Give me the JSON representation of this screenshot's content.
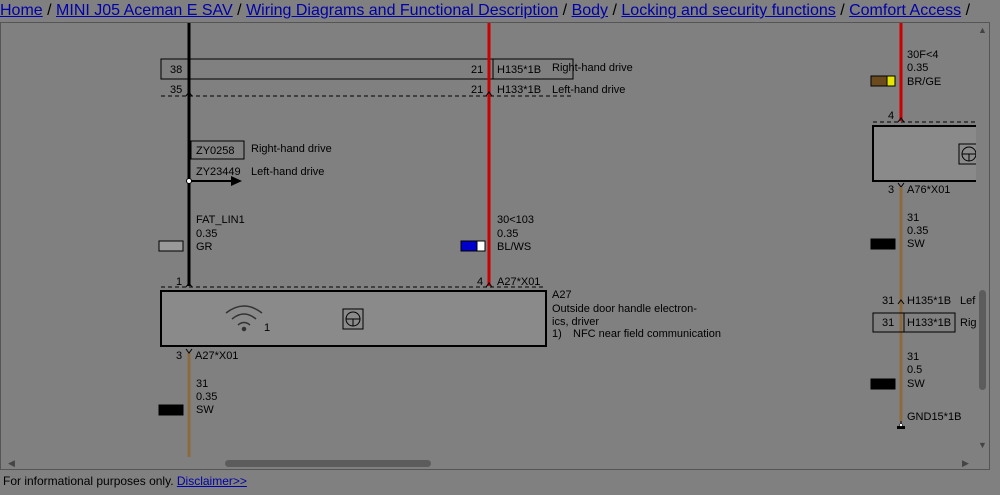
{
  "breadcrumb": {
    "items": [
      "Home",
      "MINI J05 Aceman E SAV",
      "Wiring Diagrams and Functional Description",
      "Body",
      "Locking and security functions",
      "Comfort Access"
    ],
    "separator": "/"
  },
  "diagram": {
    "pin38": "38",
    "pin21a": "21",
    "conn_h135_top": "H135*1B",
    "rhd_top": "Right-hand drive",
    "pin35": "35",
    "pin21b": "21",
    "conn_h133_top": "H133*1B",
    "lhd_top": "Left-hand drive",
    "zy0258": "ZY0258",
    "zy0258_label": "Right-hand drive",
    "zy23449": "ZY23449",
    "zy23449_label": "Left-hand drive",
    "wire_left_name": "FAT_LIN1",
    "wire_left_size": "0.35",
    "wire_left_color": "GR",
    "wire_mid_name": "30<103",
    "wire_mid_size": "0.35",
    "wire_mid_color": "BL/WS",
    "pin1": "1",
    "pin4": "4",
    "conn_a27x01_top": "A27*X01",
    "a27_id": "A27",
    "a27_desc1": "Outside door handle electron-",
    "a27_desc2": "ics, driver",
    "a27_note_num": "1)",
    "a27_note": "NFC near field communication",
    "a27_icon_num": "1",
    "pin3": "3",
    "conn_a27x01_bot": "A27*X01",
    "wire_bot_name": "31",
    "wire_bot_size": "0.35",
    "wire_bot_color": "SW",
    "right_wire1_name": "30F<4",
    "right_wire1_size": "0.35",
    "right_wire1_color": "BR/GE",
    "right_pin4": "4",
    "right_pin3": "3",
    "right_conn_a76": "A76*X01",
    "right_wire2_name": "31",
    "right_wire2_size": "0.35",
    "right_wire2_color": "SW",
    "right_pin31a": "31",
    "right_conn_h135": "H135*1B",
    "right_lef": "Lef",
    "right_pin31b": "31",
    "right_conn_h133": "H133*1B",
    "right_rig": "Rig",
    "right_wire3_name": "31",
    "right_wire3_size": "0.5",
    "right_wire3_color": "SW",
    "right_gnd": "GND15*1B"
  },
  "footer": {
    "text": "For informational purposes only.",
    "link": "Disclaimer>>"
  },
  "colors": {
    "background": "#808080",
    "red_wire": "#cc0000",
    "brown_wire": "#8b6a3e",
    "link": "#0000aa"
  },
  "icons": {
    "steering": "steering-wheel-icon",
    "wireless": "wireless-icon",
    "arrow": "arrow-right-icon",
    "ground": "ground-icon"
  }
}
